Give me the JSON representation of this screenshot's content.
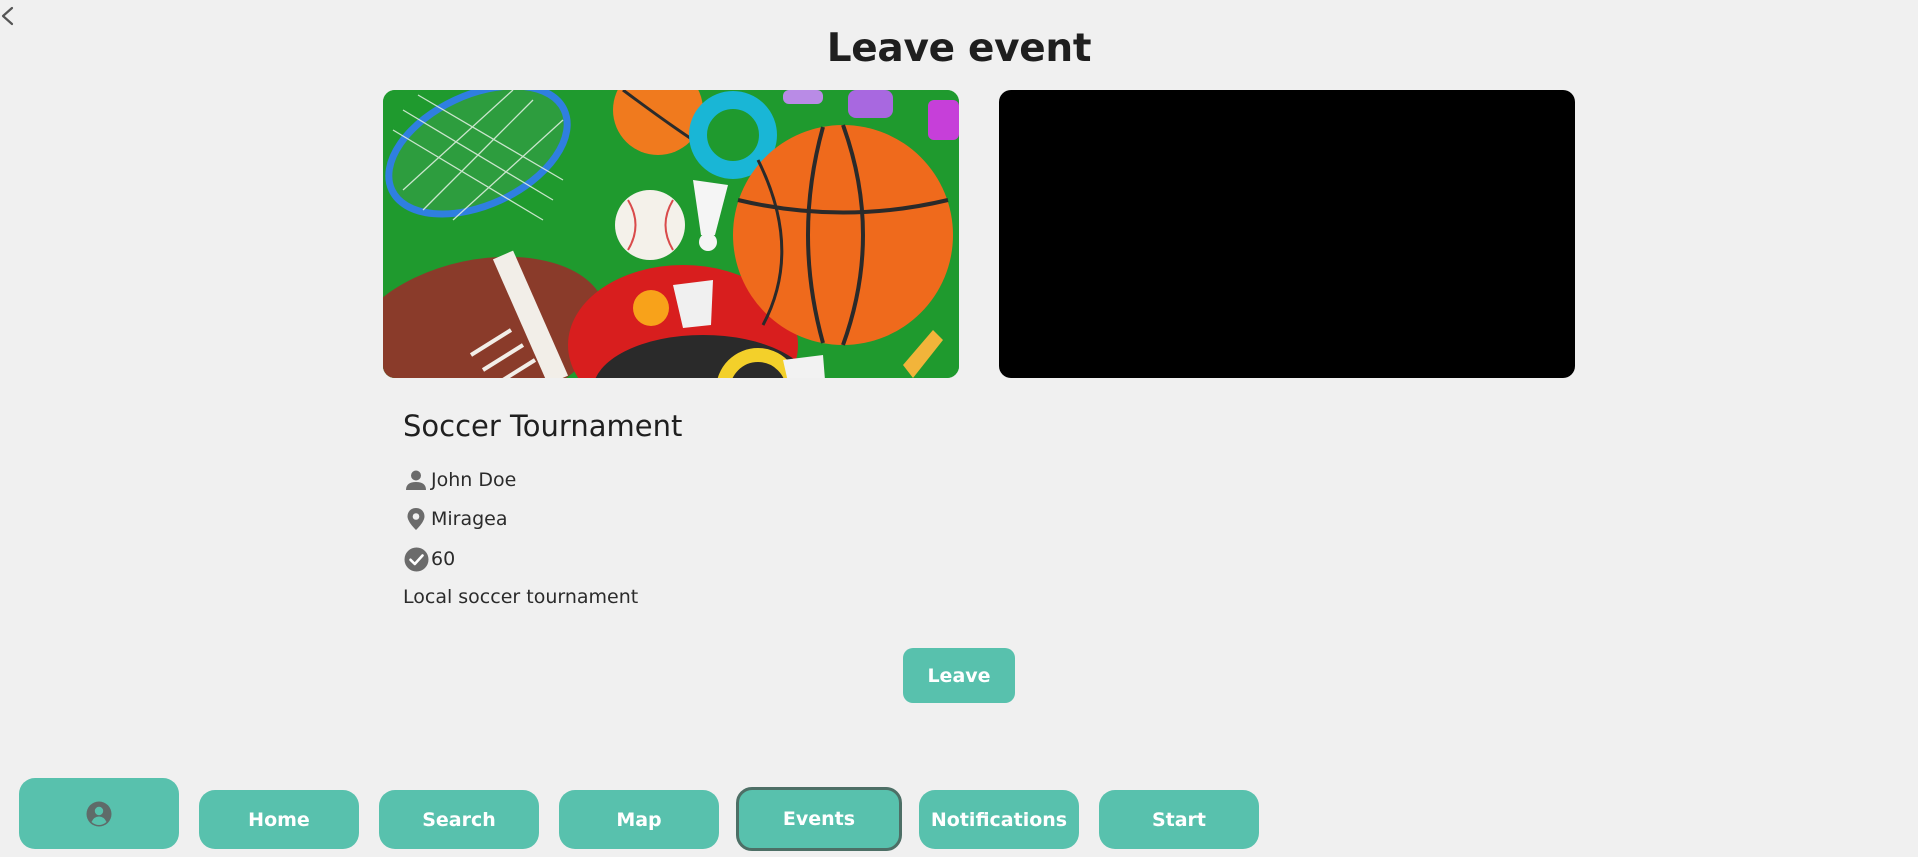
{
  "page": {
    "title": "Leave event"
  },
  "event": {
    "name": "Soccer Tournament",
    "organizer": "John Doe",
    "location": "Miragea",
    "capacity": "60",
    "description": "Local soccer tournament"
  },
  "actions": {
    "leave_label": "Leave"
  },
  "nav": {
    "profile_icon": "user-circle-icon",
    "home": "Home",
    "search": "Search",
    "map": "Map",
    "events": "Events",
    "notifications": "Notifications",
    "start": "Start"
  },
  "colors": {
    "accent": "#58c1ad",
    "background": "#f0f0f0",
    "active_border": "#4d6f66"
  }
}
